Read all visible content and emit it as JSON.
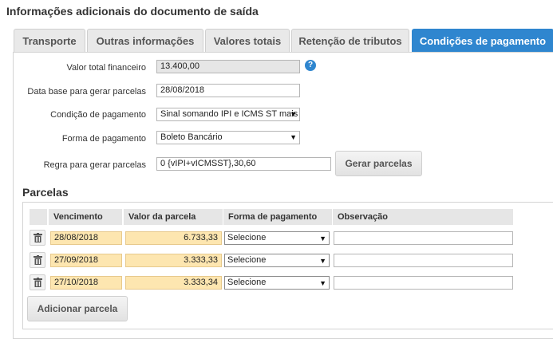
{
  "page": {
    "title": "Informações adicionais do documento de saída"
  },
  "tabs": [
    {
      "label": "Transporte"
    },
    {
      "label": "Outras informações"
    },
    {
      "label": "Valores totais"
    },
    {
      "label": "Retenção de tributos"
    },
    {
      "label": "Condições de pagamento"
    }
  ],
  "form": {
    "valor_total_label": "Valor total financeiro",
    "valor_total_value": "13.400,00",
    "help_glyph": "?",
    "data_base_label": "Data base para gerar parcelas",
    "data_base_value": "28/08/2018",
    "condicao_label": "Condição de pagamento",
    "condicao_value": "Sinal somando IPI e ICMS ST mais",
    "forma_label": "Forma de pagamento",
    "forma_value": "Boleto Bancário",
    "regra_label": "Regra para gerar parcelas",
    "regra_value": "0 {vIPI+vICMSST},30,60",
    "gerar_button": "Gerar parcelas"
  },
  "parcelas": {
    "title": "Parcelas",
    "headers": {
      "vencimento": "Vencimento",
      "valor": "Valor da parcela",
      "forma": "Forma de pagamento",
      "observacao": "Observação"
    },
    "rows": [
      {
        "vencimento": "28/08/2018",
        "valor": "6.733,33",
        "forma": "Selecione",
        "observacao": ""
      },
      {
        "vencimento": "27/09/2018",
        "valor": "3.333,33",
        "forma": "Selecione",
        "observacao": ""
      },
      {
        "vencimento": "27/10/2018",
        "valor": "3.333,34",
        "forma": "Selecione",
        "observacao": ""
      }
    ],
    "add_button": "Adicionar parcela"
  },
  "colors": {
    "accent": "#2f86cf",
    "highlight_cell": "#fde6b0",
    "header_bg": "#e6e6e6"
  }
}
